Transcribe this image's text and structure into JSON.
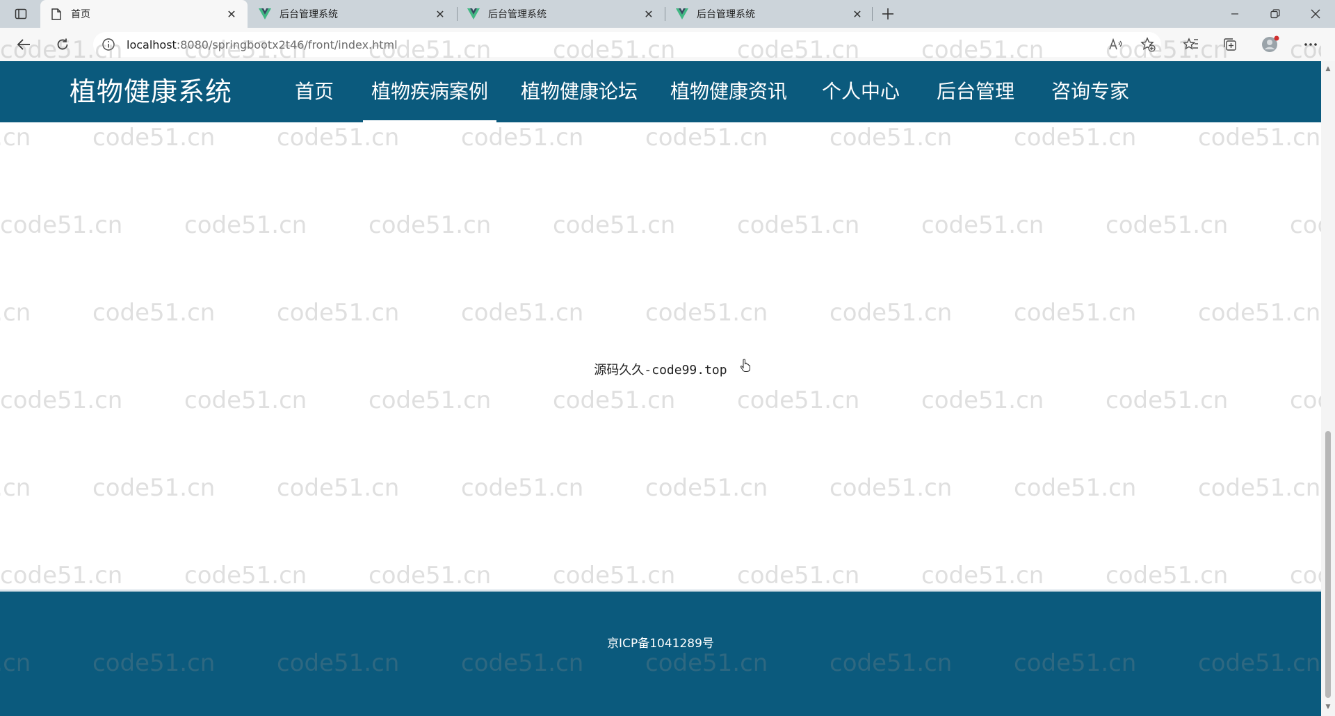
{
  "browser": {
    "tabs": [
      {
        "title": "首页",
        "icon": "page-icon",
        "active": true
      },
      {
        "title": "后台管理系统",
        "icon": "vue-logo-icon",
        "active": false
      },
      {
        "title": "后台管理系统",
        "icon": "vue-logo-icon",
        "active": false
      },
      {
        "title": "后台管理系统",
        "icon": "vue-logo-icon",
        "active": false
      }
    ],
    "url_host": "localhost",
    "url_rest": ":8080/springbootx2t46/front/index.html"
  },
  "site": {
    "title": "植物健康系统",
    "nav": [
      {
        "label": "首页",
        "active": false
      },
      {
        "label": "植物疾病案例",
        "active": true
      },
      {
        "label": "植物健康论坛",
        "active": false
      },
      {
        "label": "植物健康资讯",
        "active": false
      },
      {
        "label": "个人中心",
        "active": false
      },
      {
        "label": "后台管理",
        "active": false
      },
      {
        "label": "咨询专家",
        "active": false
      }
    ],
    "center_text": "源码久久-code99.top",
    "footer_text": "京ICP备1041289号",
    "watermark": "code51.cn"
  },
  "colors": {
    "header_bg": "#0b5a7d",
    "footer_bg": "#0b5a7d",
    "tab_strip_bg": "#ccd4da"
  }
}
